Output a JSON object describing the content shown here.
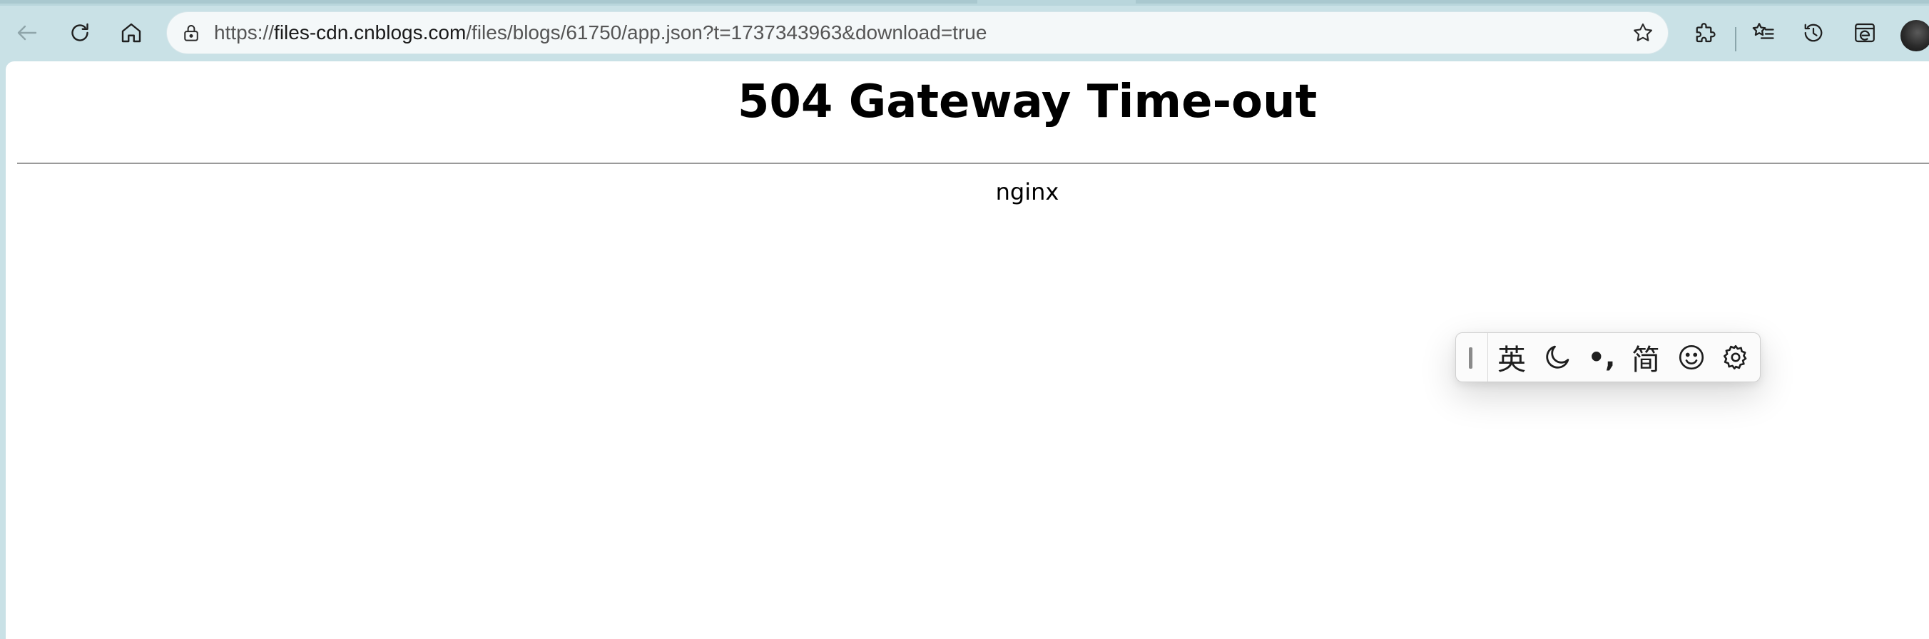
{
  "browser": {
    "address_bar": {
      "url_prefix": "https://",
      "url_host": "files-cdn.cnblogs.com",
      "url_path": "/files/blogs/61750/app.json?t=1737343963&download=true"
    },
    "toolbar_icons": {
      "back": "arrow-left-icon",
      "refresh": "refresh-icon",
      "home": "home-icon",
      "site_info": "lock-icon",
      "favorite": "star-icon",
      "extensions": "puzzle-icon",
      "favorites": "favorites-list-icon",
      "history": "history-icon",
      "ie_mode": "internet-explorer-icon",
      "profile": "avatar-icon"
    }
  },
  "page": {
    "title": "504 Gateway Time-out",
    "server": "nginx"
  },
  "ime_toolbar": {
    "language": "英",
    "theme_icon": "moon-icon",
    "punctuation": "•,",
    "charset": "简",
    "emoji_icon": "smiley-icon",
    "settings_icon": "gear-icon"
  },
  "colors": {
    "browser_chrome": "#c9e1e6",
    "page_background": "#ffffff",
    "text": "#000000"
  }
}
